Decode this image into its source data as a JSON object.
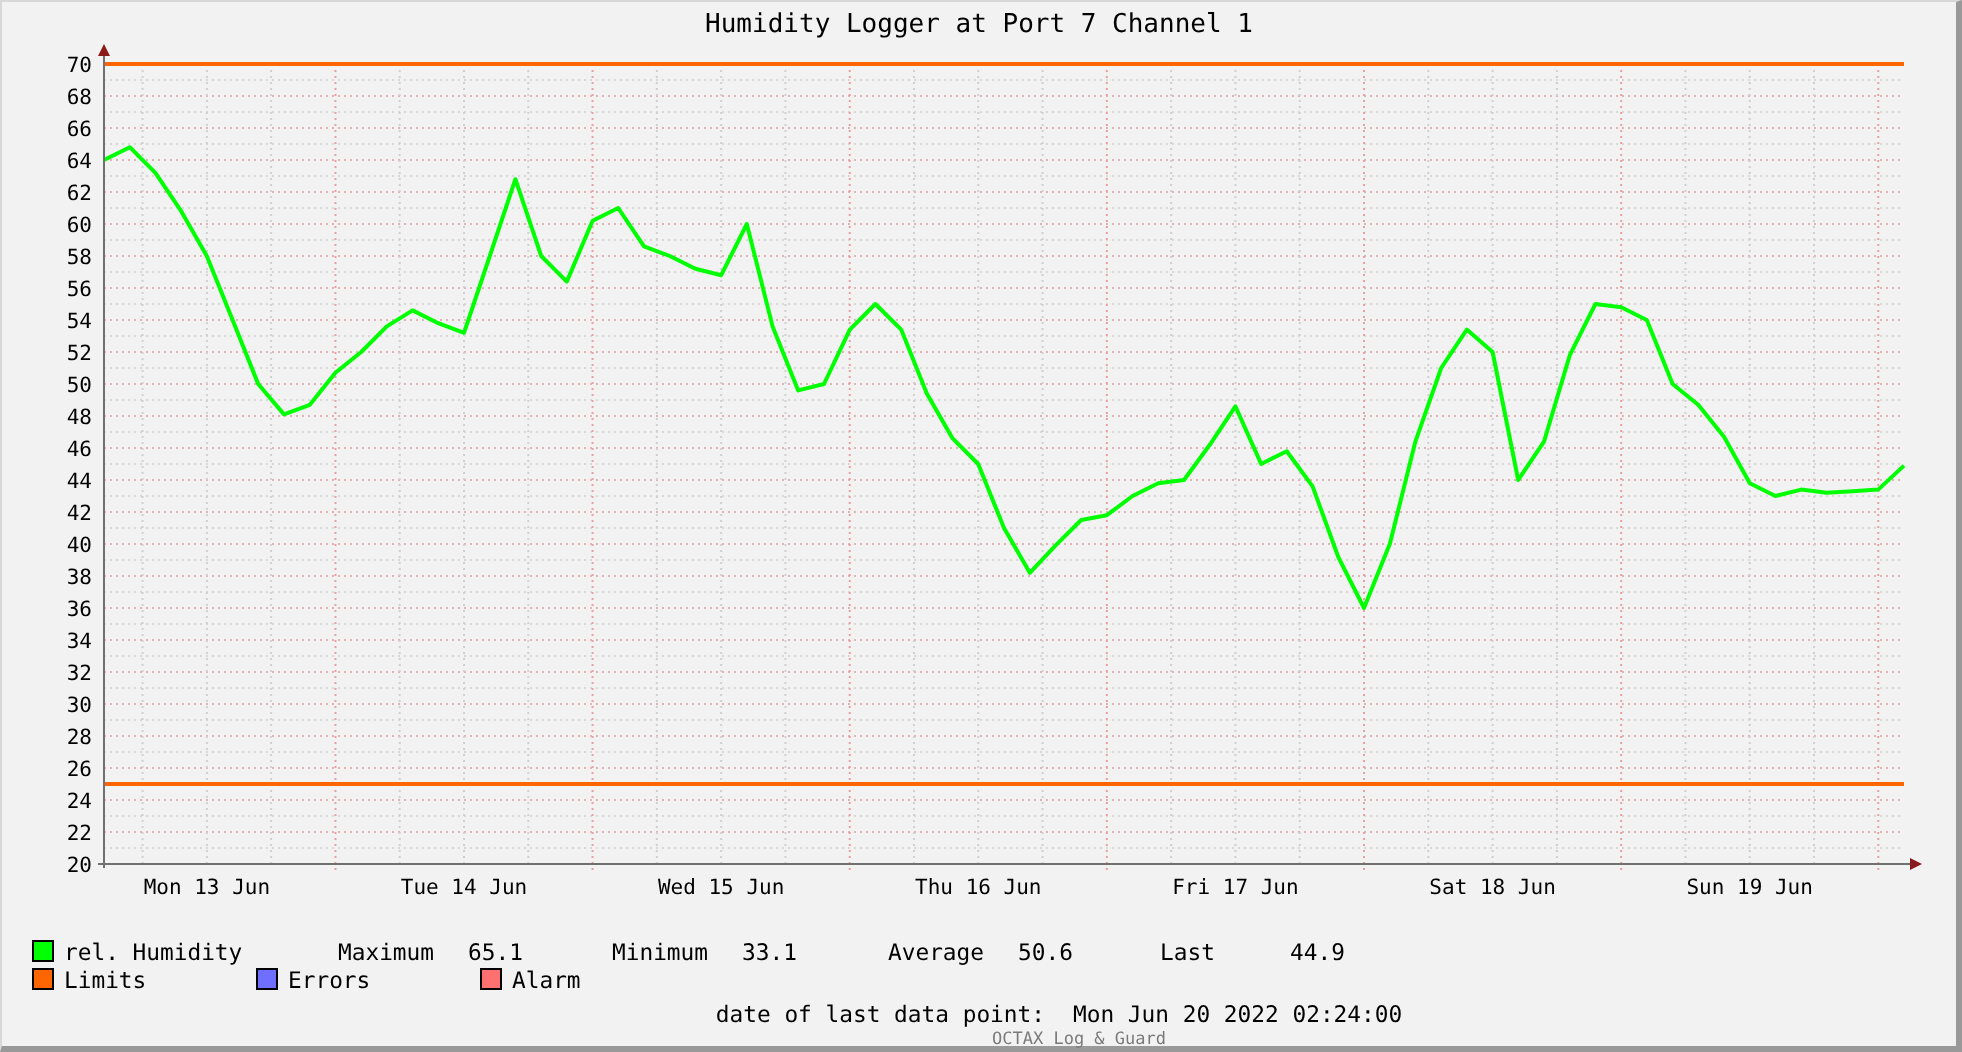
{
  "title": "Humidity Logger at Port 7 Channel 1",
  "chart_data": {
    "type": "line",
    "ylim": [
      20,
      70
    ],
    "categories": [
      null,
      null,
      null,
      null,
      "Mon 13 Jun",
      null,
      null,
      null,
      null,
      null,
      null,
      null,
      null,
      null,
      "Tue 14 Jun",
      null,
      null,
      null,
      null,
      null,
      null,
      null,
      null,
      null,
      "Wed 15 Jun",
      null,
      null,
      null,
      null,
      null,
      null,
      null,
      null,
      null,
      "Thu 16 Jun",
      null,
      null,
      null,
      null,
      null,
      null,
      null,
      null,
      null,
      "Fri 17 Jun",
      null,
      null,
      null,
      null,
      null,
      null,
      null,
      null,
      null,
      "Sat 18 Jun",
      null,
      null,
      null,
      null,
      null,
      null,
      null,
      null,
      null,
      "Sun 19 Jun",
      null,
      null,
      null,
      null,
      null,
      null
    ],
    "series": [
      {
        "name": "rel. Humidity",
        "color": "#00ff00",
        "values": [
          64,
          64.8,
          63.2,
          60.8,
          58,
          54,
          50,
          48.1,
          48.7,
          50.7,
          52,
          53.6,
          54.6,
          53.8,
          53.2,
          58,
          62.8,
          58,
          56.4,
          60.2,
          61,
          58.6,
          58,
          57.2,
          56.8,
          60,
          53.6,
          49.6,
          50,
          53.4,
          55,
          53.4,
          49.4,
          46.6,
          45,
          41,
          38.2,
          39.9,
          41.5,
          41.8,
          43,
          43.8,
          44,
          46.2,
          48.6,
          45,
          45.8,
          43.6,
          39.2,
          36,
          40,
          46.4,
          51,
          53.4,
          52,
          44,
          46.4,
          51.8,
          55,
          54.8,
          54,
          50,
          48.7,
          46.7,
          43.8,
          43,
          43.4,
          43.2,
          43.3,
          43.4,
          44.9
        ]
      }
    ],
    "yticks": [
      20,
      22,
      24,
      26,
      28,
      30,
      32,
      34,
      36,
      38,
      40,
      42,
      44,
      46,
      48,
      50,
      52,
      54,
      56,
      58,
      60,
      62,
      64,
      66,
      68,
      70
    ],
    "grid": true,
    "ref_lines": [
      {
        "axis": "y",
        "value": 70,
        "color": "#ff6600"
      },
      {
        "axis": "y",
        "value": 25,
        "color": "#ff6600"
      }
    ]
  },
  "legend": [
    {
      "color": "#00ff00",
      "stats": [
        {
          "label": "Maximum",
          "value": "65.1"
        },
        {
          "label": "Minimum",
          "value": "33.1"
        },
        {
          "label": "Average",
          "value": "50.6"
        },
        {
          "label": "Last",
          "value": "44.9"
        }
      ]
    },
    {
      "label": "Limits",
      "color": "#ff6600"
    },
    {
      "label": "Errors",
      "color": "#6f6fff"
    },
    {
      "label": "Alarm",
      "color": "#ff7070"
    }
  ],
  "last_data_point": {
    "label": "date of last data point:",
    "value": "Mon Jun 20 2022 02:24:00"
  },
  "footer": "OCTAX Log & Guard"
}
